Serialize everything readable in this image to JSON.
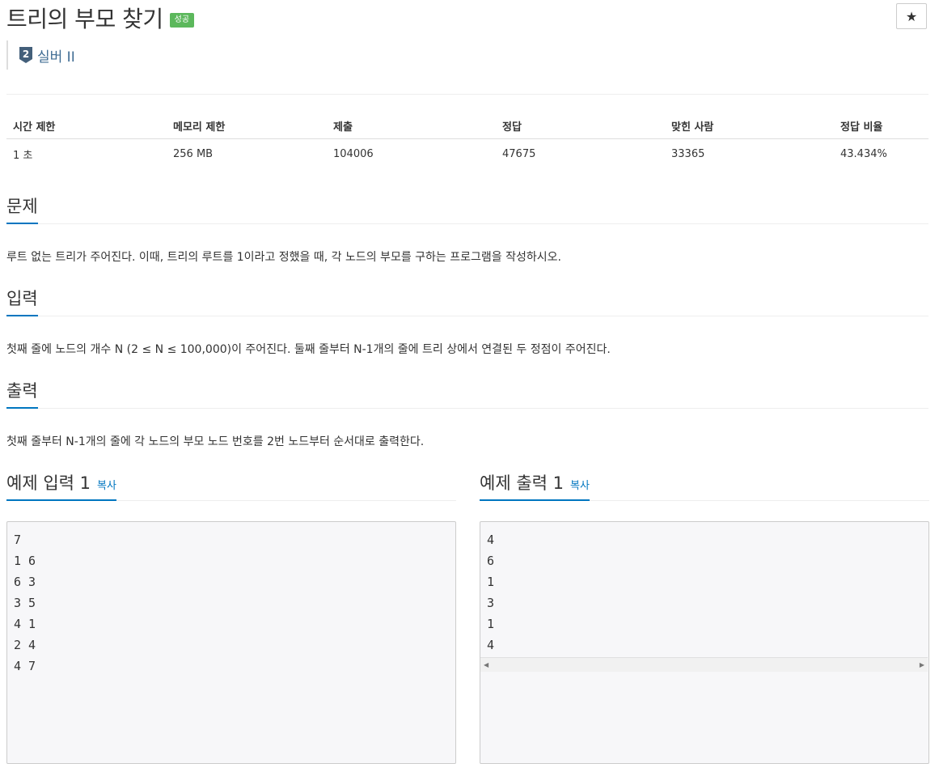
{
  "problem": {
    "title": "트리의 부모 찾기",
    "badge": "성공",
    "star_icon": "★",
    "tier": {
      "level": "2",
      "label": "실버 II",
      "color": "#3f6c93"
    }
  },
  "info_table": {
    "headers": [
      "시간 제한",
      "메모리 제한",
      "제출",
      "정답",
      "맞힌 사람",
      "정답 비율"
    ],
    "values": [
      "1 초",
      "256 MB",
      "104006",
      "47675",
      "33365",
      "43.434%"
    ]
  },
  "sections": {
    "description": {
      "title": "문제",
      "text": "루트 없는 트리가 주어진다. 이때, 트리의 루트를 1이라고 정했을 때, 각 노드의 부모를 구하는 프로그램을 작성하시오."
    },
    "input": {
      "title": "입력",
      "text": "첫째 줄에 노드의 개수 N (2 ≤ N ≤ 100,000)이 주어진다. 둘째 줄부터 N-1개의 줄에 트리 상에서 연결된 두 정점이 주어진다."
    },
    "output": {
      "title": "출력",
      "text": "첫째 줄부터 N-1개의 줄에 각 노드의 부모 노드 번호를 2번 노드부터 순서대로 출력한다."
    }
  },
  "samples": {
    "copy_label": "복사",
    "input": {
      "title": "예제 입력 1",
      "lines": [
        "7",
        "1 6",
        "6 3",
        "3 5",
        "4 1",
        "2 4",
        "4 7"
      ]
    },
    "output": {
      "title": "예제 출력 1",
      "lines": [
        "4",
        "6",
        "1",
        "3",
        "1",
        "4"
      ]
    }
  },
  "colors": {
    "accent": "#0076c0",
    "success": "#5cb85c",
    "tier": "#3f6c93"
  }
}
